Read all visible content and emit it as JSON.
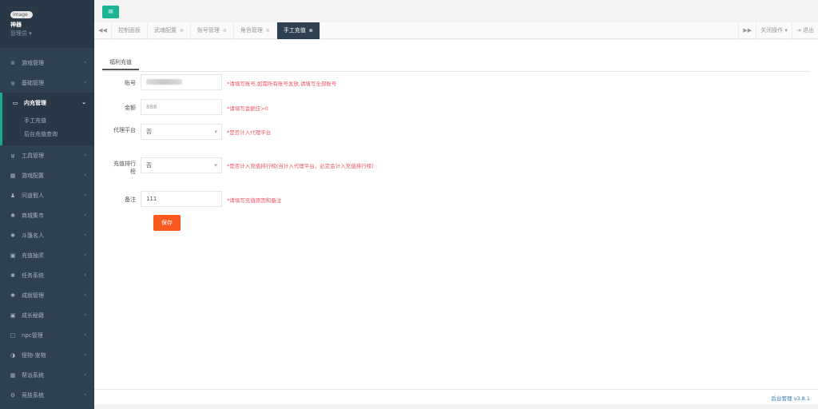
{
  "profile": {
    "logo_text": "image",
    "name": "神器",
    "role": "管理员 ▾"
  },
  "menu": [
    {
      "label": "游戏管理",
      "icon": "gamepad-icon",
      "glyph": "⊚"
    },
    {
      "label": "基础管理",
      "icon": "cutlery-icon",
      "glyph": "ψ"
    },
    {
      "label": "内充管理",
      "icon": "monitor-icon",
      "glyph": "▭",
      "active": true,
      "children": [
        "手工充值",
        "后台充值查询"
      ]
    },
    {
      "label": "工具管理",
      "icon": "cutlery-icon",
      "glyph": "ψ"
    },
    {
      "label": "游戏配置",
      "icon": "grid-icon",
      "glyph": "▦"
    },
    {
      "label": "问道假人",
      "icon": "user-icon",
      "glyph": "♟"
    },
    {
      "label": "商城集市",
      "icon": "bug-icon",
      "glyph": "✱"
    },
    {
      "label": "斗篷名人",
      "icon": "bug-icon",
      "glyph": "✱"
    },
    {
      "label": "充值抽奖",
      "icon": "card-icon",
      "glyph": "▣"
    },
    {
      "label": "任务系统",
      "icon": "bug-icon",
      "glyph": "✱"
    },
    {
      "label": "成就管理",
      "icon": "bug-icon",
      "glyph": "✱"
    },
    {
      "label": "成长秘籍",
      "icon": "card-icon",
      "glyph": "▣"
    },
    {
      "label": "npc管理",
      "icon": "square-icon",
      "glyph": "▢"
    },
    {
      "label": "怪物-宠物",
      "icon": "adjust-icon",
      "glyph": "◑"
    },
    {
      "label": "帮派系统",
      "icon": "grid-icon",
      "glyph": "▦"
    },
    {
      "label": "竞技系统",
      "icon": "cogs-icon",
      "glyph": "⚙"
    }
  ],
  "tabs": {
    "prev": "◀◀",
    "items": [
      {
        "label": "控制面板",
        "closable": false,
        "active": false
      },
      {
        "label": "武魂配置",
        "closable": true,
        "active": false
      },
      {
        "label": "账号管理",
        "closable": true,
        "active": false
      },
      {
        "label": "角色管理",
        "closable": true,
        "active": false
      },
      {
        "label": "手工充值",
        "closable": true,
        "active": true
      }
    ],
    "next": "▶▶",
    "close_ops": "关闭操作 ▾",
    "logout": "⇥ 退出"
  },
  "form": {
    "tab_title": "福利充值",
    "account": {
      "label": "账号",
      "hint": "*请填写账号,如需所有账号发放,请填写全部账号"
    },
    "amount": {
      "label": "金额",
      "placeholder": "888",
      "hint": "*请填写金额应>0"
    },
    "agent": {
      "label": "代理平台",
      "value": "否",
      "hint": "*是否计入代理平台"
    },
    "ranking": {
      "label": "充值排行榜",
      "value": "否",
      "hint": "*是否计入充值排行榜(当计入代理平台，必定会计入充值排行榜)"
    },
    "remark": {
      "label": "备注",
      "value": "111",
      "hint": "*请填写充值原因和备注"
    },
    "save_label": "保存"
  },
  "footer": {
    "version": "后台管理 v3.8.1"
  },
  "colors": {
    "sidebar": "#2f4050",
    "accent": "#1ab394",
    "save": "#f8591f",
    "hint": "#ed5565"
  }
}
